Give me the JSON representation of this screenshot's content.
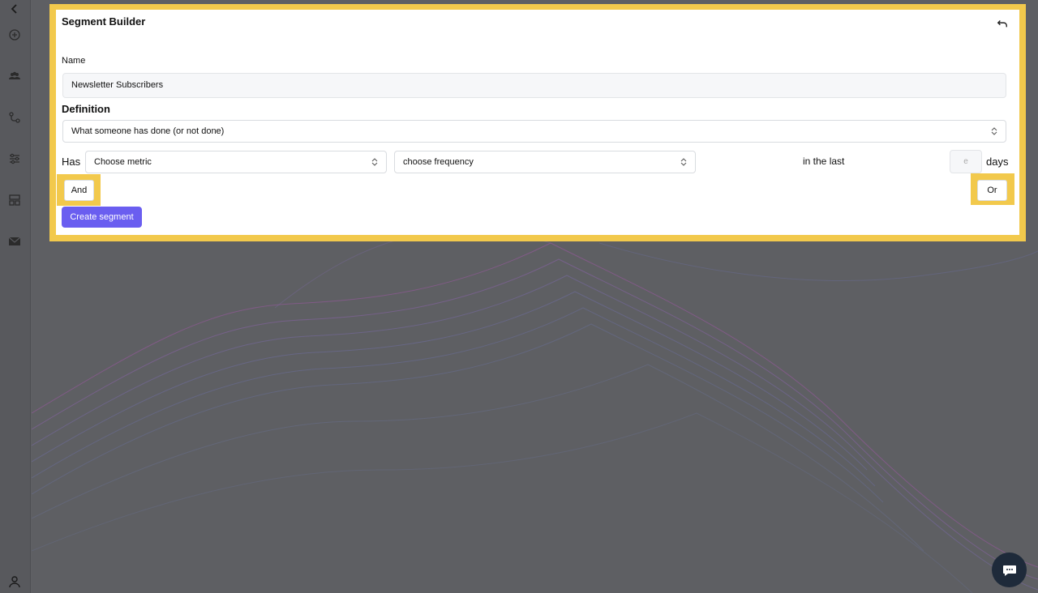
{
  "sidebar": {
    "items": [
      {
        "icon": "chevron-left-icon"
      },
      {
        "icon": "add-circle-icon"
      },
      {
        "icon": "users-icon"
      },
      {
        "icon": "flow-icon"
      },
      {
        "icon": "filters-icon"
      },
      {
        "icon": "layout-icon"
      },
      {
        "icon": "mail-icon"
      },
      {
        "icon": "user-icon"
      }
    ]
  },
  "modal": {
    "title": "Segment Builder",
    "name_label": "Name",
    "name_value": "Newsletter Subscribers",
    "definition_label": "Definition",
    "definition_select": "What someone has done (or not done)",
    "has_label": "Has",
    "metric_select": "Choose metric",
    "frequency_select": "choose frequency",
    "in_the_last": "in the last",
    "days_placeholder": "e",
    "days_label": "days",
    "and_button": "And",
    "or_button": "Or",
    "create_button": "Create segment"
  },
  "colors": {
    "highlight": "#f2c94c",
    "primary": "#6a5ef0",
    "chat_bg": "#1e2a3a"
  }
}
